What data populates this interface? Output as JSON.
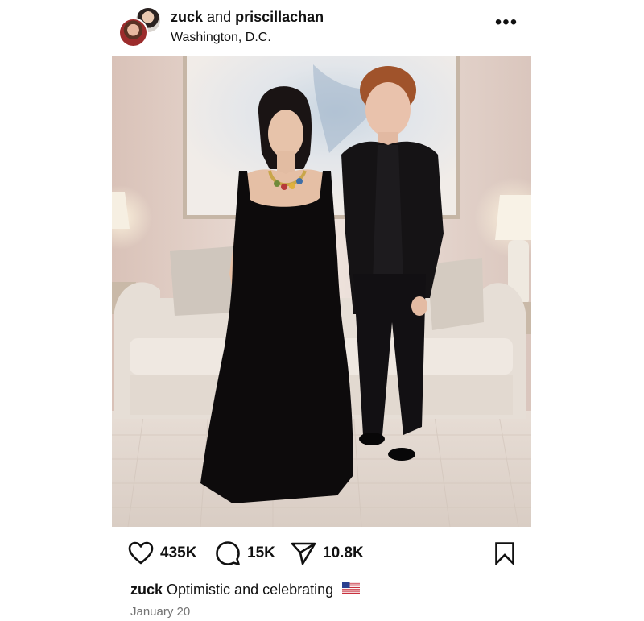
{
  "header": {
    "username_primary": "zuck",
    "joiner": "and",
    "username_collaborator": "priscillachan",
    "location": "Washington, D.C.",
    "more_icon": "more-horizontal-icon",
    "more_glyph": "•••"
  },
  "photo": {
    "description_icon": "post-photo"
  },
  "actions": {
    "like_count": "435K",
    "comment_count": "15K",
    "share_count": "10.8K"
  },
  "caption": {
    "username": "zuck",
    "text": "Optimistic and celebrating"
  },
  "date": "January 20",
  "colors": {
    "text": "#111111",
    "muted": "#737373",
    "background": "#ffffff"
  }
}
